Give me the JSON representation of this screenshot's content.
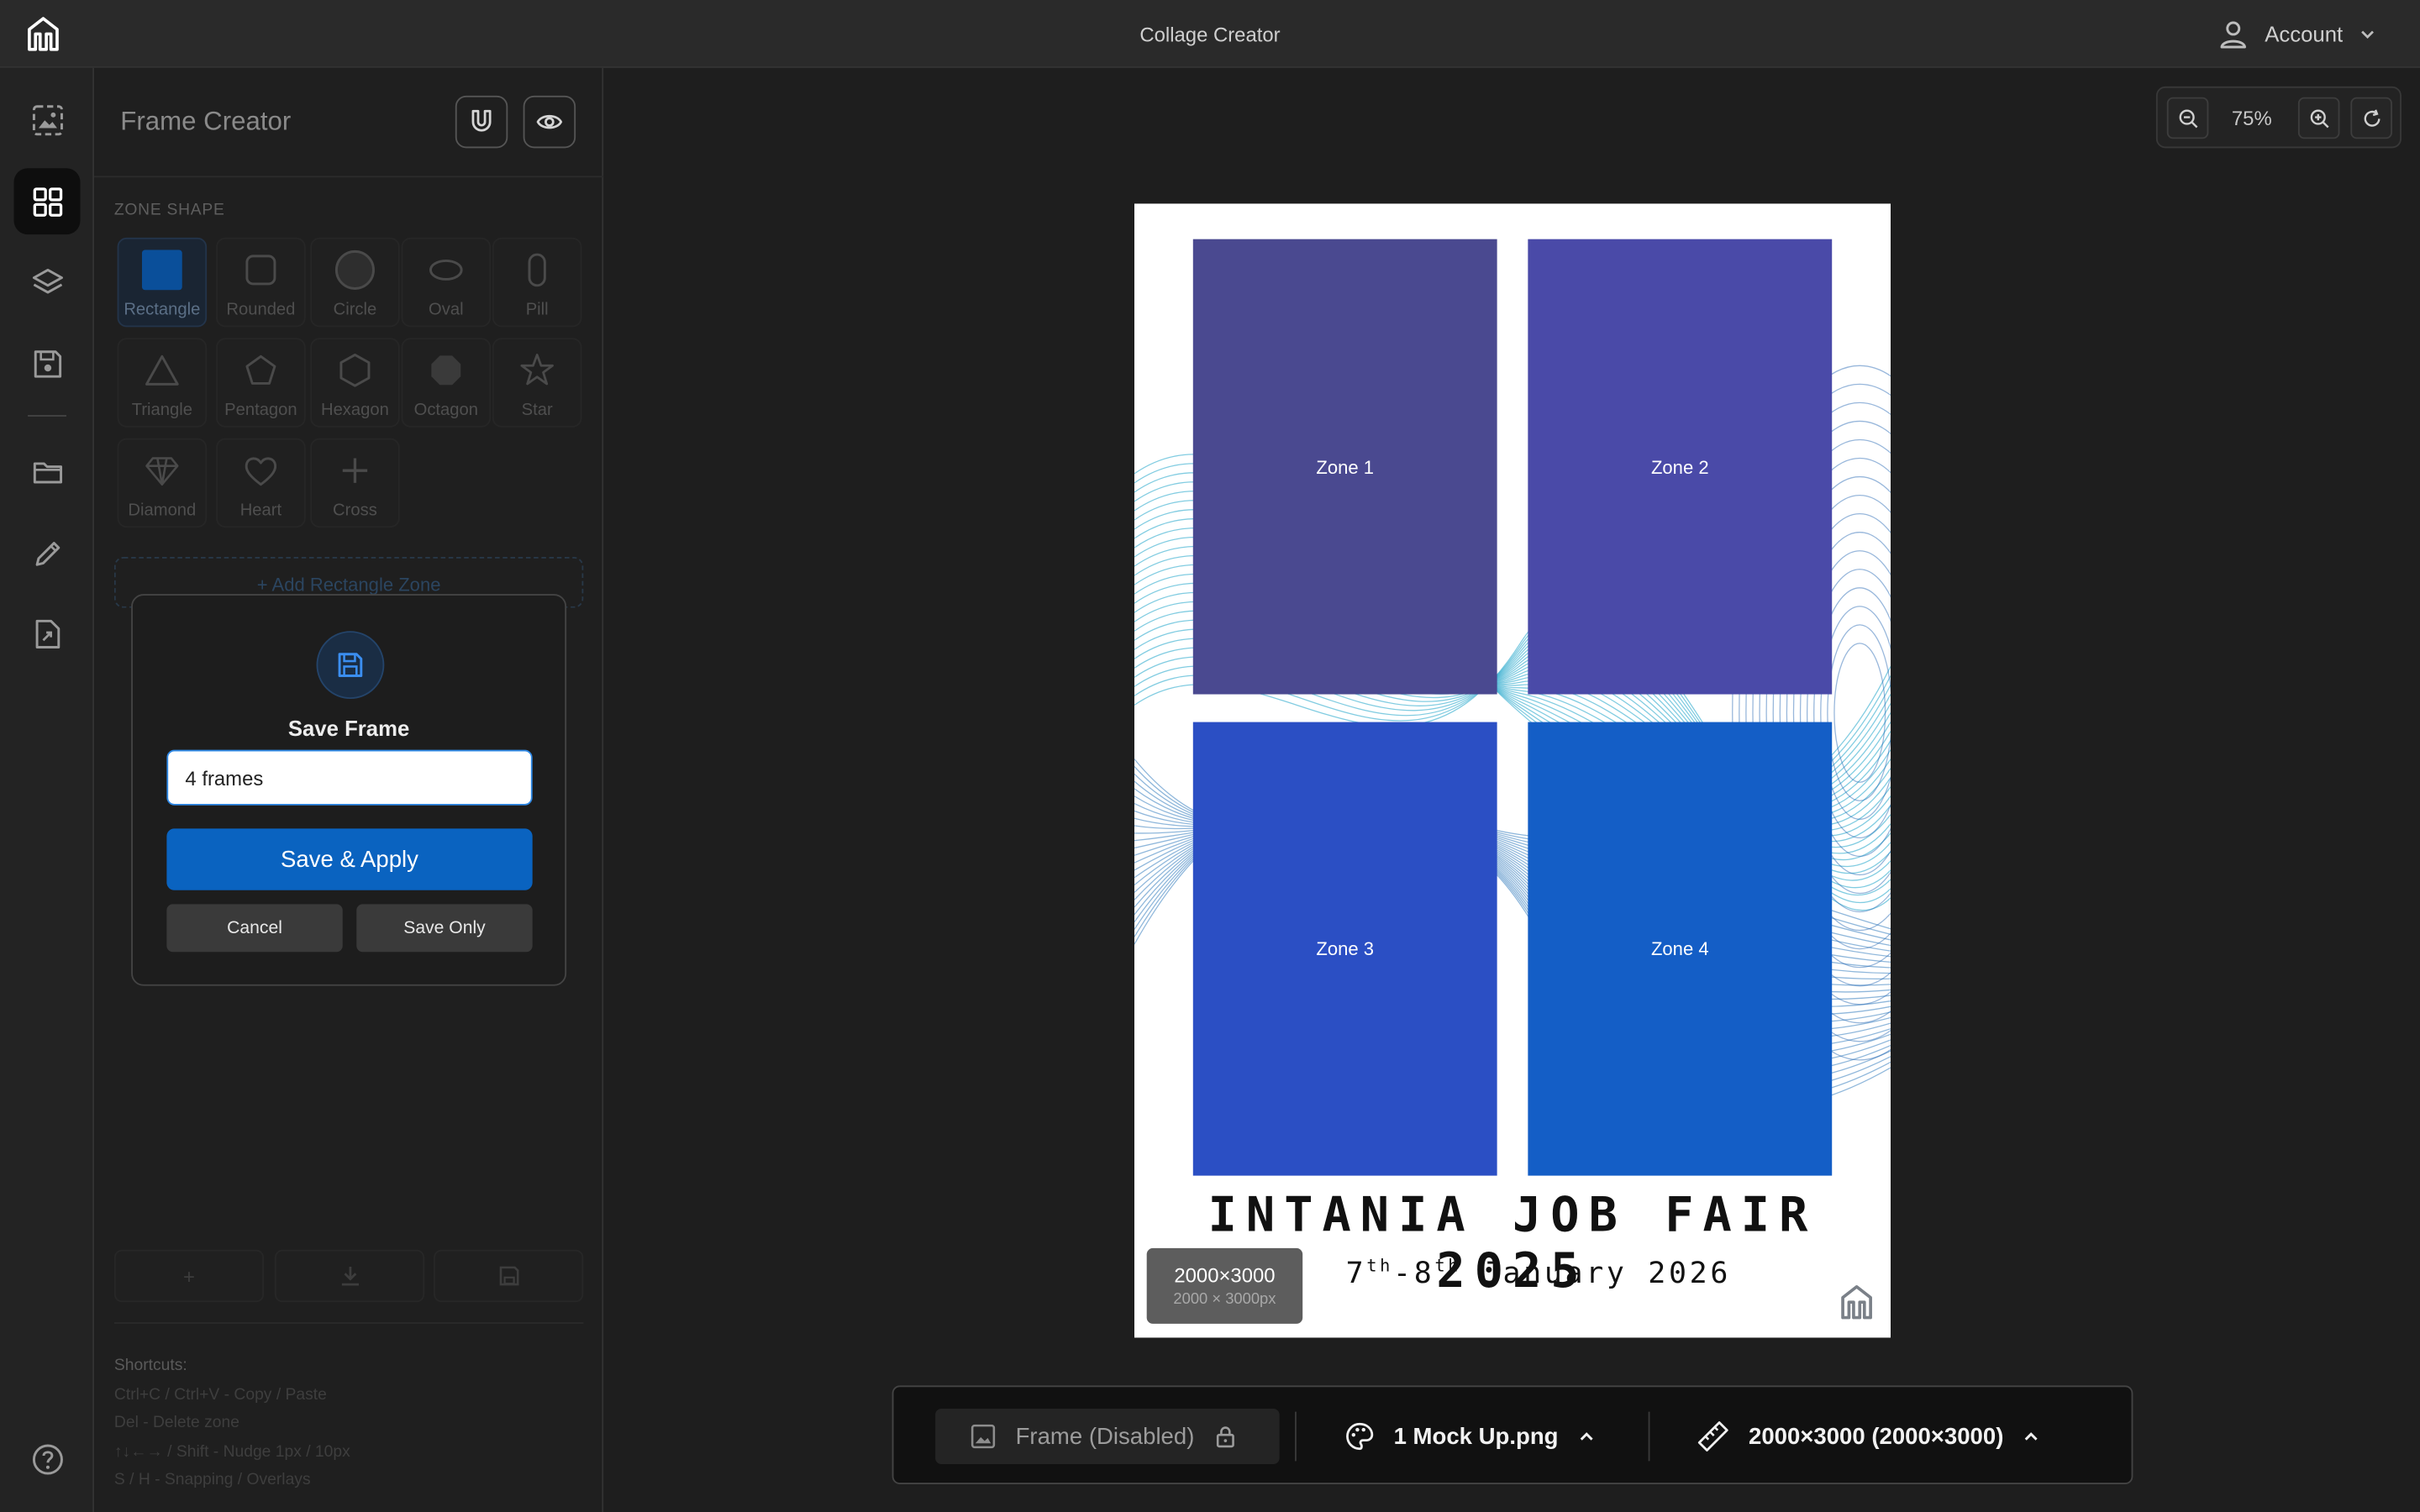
{
  "app": {
    "title": "Collage Creator"
  },
  "header": {
    "account_label": "Account"
  },
  "sidebar": {
    "items": [
      {
        "name": "image-frame",
        "active": false
      },
      {
        "name": "grid-layout",
        "active": true
      },
      {
        "name": "layers",
        "active": false
      },
      {
        "name": "save",
        "active": false
      },
      {
        "name": "folder",
        "active": false
      },
      {
        "name": "edit",
        "active": false
      },
      {
        "name": "export-file",
        "active": false
      }
    ],
    "help_icon": "help-icon"
  },
  "panel": {
    "title": "Frame Creator",
    "section_label": "ZONE SHAPE",
    "shapes": [
      {
        "label": "Rectangle",
        "selected": true
      },
      {
        "label": "Rounded"
      },
      {
        "label": "Circle"
      },
      {
        "label": "Oval"
      },
      {
        "label": "Pill"
      },
      {
        "label": "Triangle"
      },
      {
        "label": "Pentagon"
      },
      {
        "label": "Hexagon"
      },
      {
        "label": "Octagon"
      },
      {
        "label": "Star"
      },
      {
        "label": "Diamond"
      },
      {
        "label": "Heart"
      },
      {
        "label": "Cross"
      }
    ],
    "add_zone_label": "+ Add Rectangle Zone",
    "shortcuts": {
      "heading": "Shortcuts:",
      "lines": [
        "Ctrl+C / Ctrl+V - Copy / Paste",
        "Del - Delete zone",
        "↑↓←→ / Shift - Nudge 1px / 10px",
        "S / H - Snapping / Overlays"
      ]
    }
  },
  "modal": {
    "title": "Save Frame",
    "name_value": "4 frames",
    "apply_label": "Save & Apply",
    "cancel_label": "Cancel",
    "save_only_label": "Save Only"
  },
  "zoom": {
    "value": "75%"
  },
  "canvas": {
    "zones": [
      {
        "label": "Zone 1",
        "color": "#4a4990"
      },
      {
        "label": "Zone 2",
        "color": "#4a4aa8"
      },
      {
        "label": "Zone 3",
        "color": "#2b4fc4"
      },
      {
        "label": "Zone 4",
        "color": "#145ec6"
      }
    ],
    "poster_title": "INTANIA JOB FAIR 2025",
    "poster_date": {
      "d1": "7",
      "s1": "th",
      "dash": "-",
      "d2": "8",
      "s2": "th",
      "rest": " January 2026"
    },
    "size_badge": {
      "primary": "2000×3000",
      "secondary": "2000 × 3000px"
    }
  },
  "bottom_bar": {
    "frame_label": "Frame (Disabled)",
    "mockup_label": "1 Mock Up.png",
    "size_label": "2000×3000 (2000×3000)"
  },
  "colors": {
    "accent": "#0a63c0",
    "input_border": "#2f89e6",
    "wave": "#1aa3c8"
  }
}
